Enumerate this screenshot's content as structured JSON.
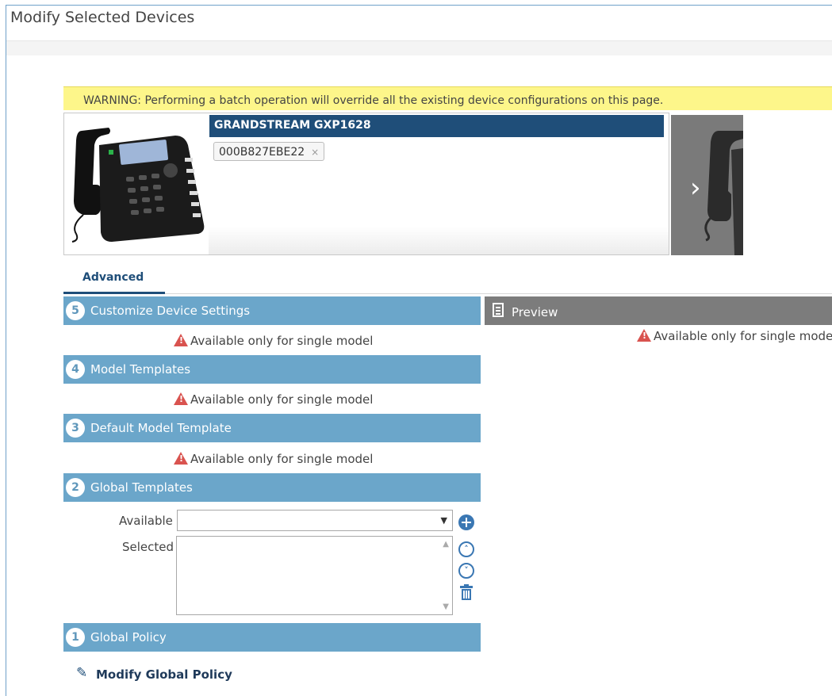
{
  "window": {
    "title": "Modify Selected Devices"
  },
  "warning": {
    "text": "WARNING: Performing a batch operation will override all the existing device configurations on this page."
  },
  "device": {
    "model": "GRANDSTREAM GXP1628",
    "mac": "000B827EBE22",
    "remove_glyph": "×",
    "next_glyph": "›"
  },
  "tabs": [
    {
      "label": "Advanced",
      "active": true
    }
  ],
  "sections": [
    {
      "num": "5",
      "label": "Customize Device Settings",
      "message": "Available only for single model"
    },
    {
      "num": "4",
      "label": "Model Templates",
      "message": "Available only for single model"
    },
    {
      "num": "3",
      "label": "Default Model Template",
      "message": "Available only for single model"
    },
    {
      "num": "2",
      "label": "Global Templates"
    },
    {
      "num": "1",
      "label": "Global Policy"
    }
  ],
  "preview": {
    "label": "Preview",
    "message": "Available only for single mode"
  },
  "global_templates": {
    "available_label": "Available",
    "selected_label": "Selected",
    "available_value": ""
  },
  "global_policy": {
    "modify_label": "Modify Global Policy"
  },
  "icons": {
    "warning": "warning-triangle-icon",
    "add": "plus-circle-icon",
    "move_up": "chevron-up-circle-icon",
    "move_down": "chevron-down-circle-icon",
    "delete": "trash-icon",
    "edit": "pencil-icon",
    "preview": "document-icon"
  },
  "colors": {
    "section_header": "#6ba6ca",
    "model_bar": "#1f4e79",
    "warning_bg": "#fdf68a",
    "preview_header": "#7c7c7c",
    "alert": "#d9534f",
    "action_icon": "#3a77b3"
  }
}
